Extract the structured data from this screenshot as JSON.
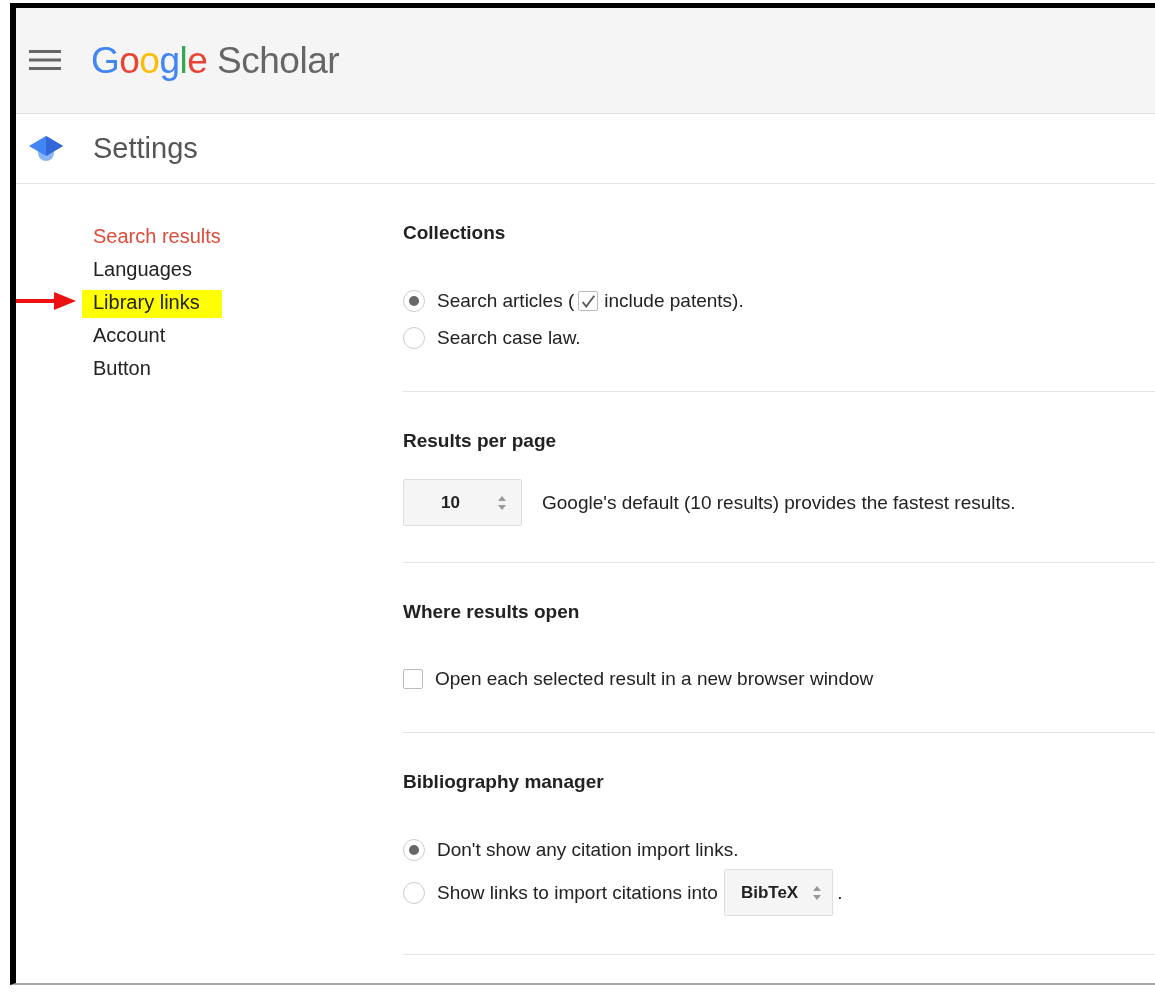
{
  "header": {
    "logo_brand": "Google",
    "logo_product": "Scholar"
  },
  "page_title": "Settings",
  "sidebar": {
    "items": [
      {
        "label": "Search results",
        "selected": true,
        "highlighted": false
      },
      {
        "label": "Languages",
        "selected": false,
        "highlighted": false
      },
      {
        "label": "Library links",
        "selected": false,
        "highlighted": true
      },
      {
        "label": "Account",
        "selected": false,
        "highlighted": false
      },
      {
        "label": "Button",
        "selected": false,
        "highlighted": false
      }
    ]
  },
  "sections": [
    {
      "title": "Collections",
      "kind": "radios",
      "options": [
        {
          "label": "Search articles (",
          "selected": true,
          "checkbox": {
            "checked": true,
            "label": "include patents)."
          }
        },
        {
          "label": "Search case law.",
          "selected": false
        }
      ]
    },
    {
      "title": "Results per page",
      "kind": "select",
      "value": "10",
      "note": "Google's default (10 results) provides the fastest results."
    },
    {
      "title": "Where results open",
      "kind": "checkbox",
      "checked": false,
      "label": "Open each selected result in a new browser window"
    },
    {
      "title": "Bibliography manager",
      "kind": "radios",
      "options": [
        {
          "label": "Don't show any citation import links.",
          "selected": true
        },
        {
          "label": "Show links to import citations into",
          "selected": false,
          "select": "BibTeX",
          "suffix": "."
        }
      ]
    }
  ]
}
